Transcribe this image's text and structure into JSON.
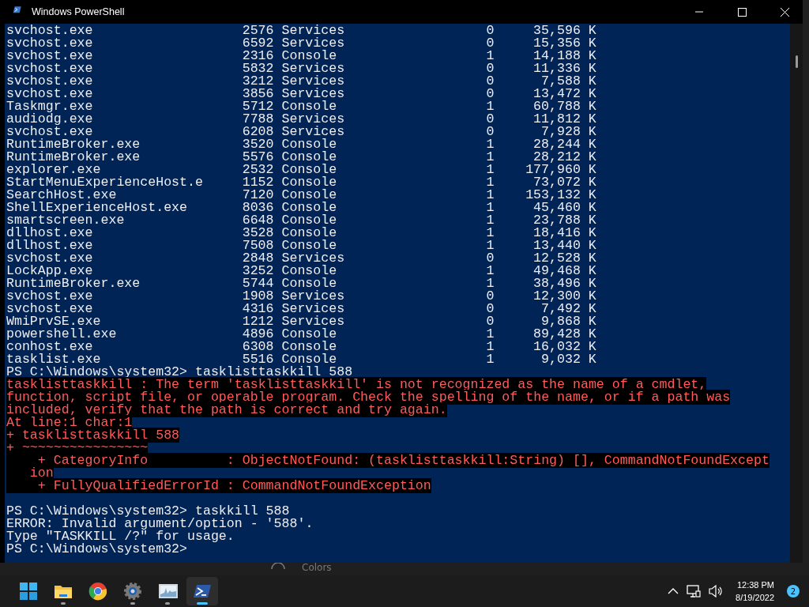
{
  "window": {
    "title": "Windows PowerShell"
  },
  "console": {
    "process_rows": [
      {
        "image": "svchost.exe",
        "pid": "2576",
        "session": "Services",
        "session_number": "0",
        "mem": "35,596 K"
      },
      {
        "image": "svchost.exe",
        "pid": "6592",
        "session": "Services",
        "session_number": "0",
        "mem": "15,356 K"
      },
      {
        "image": "svchost.exe",
        "pid": "2316",
        "session": "Console",
        "session_number": "1",
        "mem": "14,188 K"
      },
      {
        "image": "svchost.exe",
        "pid": "5832",
        "session": "Services",
        "session_number": "0",
        "mem": "11,336 K"
      },
      {
        "image": "svchost.exe",
        "pid": "3212",
        "session": "Services",
        "session_number": "0",
        "mem": "7,588 K"
      },
      {
        "image": "svchost.exe",
        "pid": "3856",
        "session": "Services",
        "session_number": "0",
        "mem": "13,472 K"
      },
      {
        "image": "Taskmgr.exe",
        "pid": "5712",
        "session": "Console",
        "session_number": "1",
        "mem": "60,788 K"
      },
      {
        "image": "audiodg.exe",
        "pid": "7788",
        "session": "Services",
        "session_number": "0",
        "mem": "11,812 K"
      },
      {
        "image": "svchost.exe",
        "pid": "6208",
        "session": "Services",
        "session_number": "0",
        "mem": "7,928 K"
      },
      {
        "image": "RuntimeBroker.exe",
        "pid": "3520",
        "session": "Console",
        "session_number": "1",
        "mem": "28,244 K"
      },
      {
        "image": "RuntimeBroker.exe",
        "pid": "5576",
        "session": "Console",
        "session_number": "1",
        "mem": "28,212 K"
      },
      {
        "image": "explorer.exe",
        "pid": "2532",
        "session": "Console",
        "session_number": "1",
        "mem": "177,960 K"
      },
      {
        "image": "StartMenuExperienceHost.e",
        "pid": "1152",
        "session": "Console",
        "session_number": "1",
        "mem": "73,072 K"
      },
      {
        "image": "SearchHost.exe",
        "pid": "7120",
        "session": "Console",
        "session_number": "1",
        "mem": "153,132 K"
      },
      {
        "image": "ShellExperienceHost.exe",
        "pid": "8036",
        "session": "Console",
        "session_number": "1",
        "mem": "45,460 K"
      },
      {
        "image": "smartscreen.exe",
        "pid": "6648",
        "session": "Console",
        "session_number": "1",
        "mem": "23,788 K"
      },
      {
        "image": "dllhost.exe",
        "pid": "3528",
        "session": "Console",
        "session_number": "1",
        "mem": "18,416 K"
      },
      {
        "image": "dllhost.exe",
        "pid": "7508",
        "session": "Console",
        "session_number": "1",
        "mem": "13,440 K"
      },
      {
        "image": "svchost.exe",
        "pid": "2848",
        "session": "Services",
        "session_number": "0",
        "mem": "12,528 K"
      },
      {
        "image": "LockApp.exe",
        "pid": "3252",
        "session": "Console",
        "session_number": "1",
        "mem": "49,468 K"
      },
      {
        "image": "RuntimeBroker.exe",
        "pid": "5744",
        "session": "Console",
        "session_number": "1",
        "mem": "38,496 K"
      },
      {
        "image": "svchost.exe",
        "pid": "1908",
        "session": "Services",
        "session_number": "0",
        "mem": "12,300 K"
      },
      {
        "image": "svchost.exe",
        "pid": "4316",
        "session": "Services",
        "session_number": "0",
        "mem": "7,492 K"
      },
      {
        "image": "WmiPrvSE.exe",
        "pid": "1212",
        "session": "Services",
        "session_number": "0",
        "mem": "9,868 K"
      },
      {
        "image": "powershell.exe",
        "pid": "4896",
        "session": "Console",
        "session_number": "1",
        "mem": "89,428 K"
      },
      {
        "image": "conhost.exe",
        "pid": "6308",
        "session": "Console",
        "session_number": "1",
        "mem": "16,032 K"
      },
      {
        "image": "tasklist.exe",
        "pid": "5516",
        "session": "Console",
        "session_number": "1",
        "mem": "9,032 K"
      }
    ],
    "output": [
      {
        "kind": "prompt",
        "text": "PS C:\\Windows\\system32> tasklisttaskkill 588"
      },
      {
        "kind": "error",
        "text": "tasklisttaskkill : The term 'tasklisttaskkill' is not recognized as the name of a cmdlet,"
      },
      {
        "kind": "error",
        "text": "function, script file, or operable program. Check the spelling of the name, or if a path was"
      },
      {
        "kind": "error",
        "text": "included, verify that the path is correct and try again."
      },
      {
        "kind": "error",
        "text": "At line:1 char:1"
      },
      {
        "kind": "error",
        "text": "+ tasklisttaskkill 588"
      },
      {
        "kind": "error",
        "text": "+ ~~~~~~~~~~~~~~~~"
      },
      {
        "kind": "error",
        "text": "    + CategoryInfo          : ObjectNotFound: (tasklisttaskkill:String) [], CommandNotFoundExcept"
      },
      {
        "kind": "error",
        "text": "   ion"
      },
      {
        "kind": "error",
        "text": "    + FullyQualifiedErrorId : CommandNotFoundException"
      },
      {
        "kind": "blank"
      },
      {
        "kind": "prompt",
        "text": "PS C:\\Windows\\system32> taskkill 588"
      },
      {
        "kind": "output",
        "text": "ERROR: Invalid argument/option - '588'."
      },
      {
        "kind": "output",
        "text": "Type \"TASKKILL /?\" for usage."
      },
      {
        "kind": "prompt",
        "text": "PS C:\\Windows\\system32>"
      }
    ]
  },
  "background_window": {
    "label": "Colors"
  },
  "taskbar": {
    "apps": [
      {
        "kind": "start",
        "selected": false,
        "running": false
      },
      {
        "kind": "folder",
        "selected": false,
        "running": true
      },
      {
        "kind": "browser",
        "selected": false,
        "running": false
      },
      {
        "kind": "gear",
        "selected": false,
        "running": true
      },
      {
        "kind": "monitor",
        "selected": false,
        "running": true
      },
      {
        "kind": "shell",
        "selected": true,
        "running": true
      }
    ],
    "time": "12:38 PM",
    "date": "8/19/2022",
    "notification_count": "2"
  }
}
